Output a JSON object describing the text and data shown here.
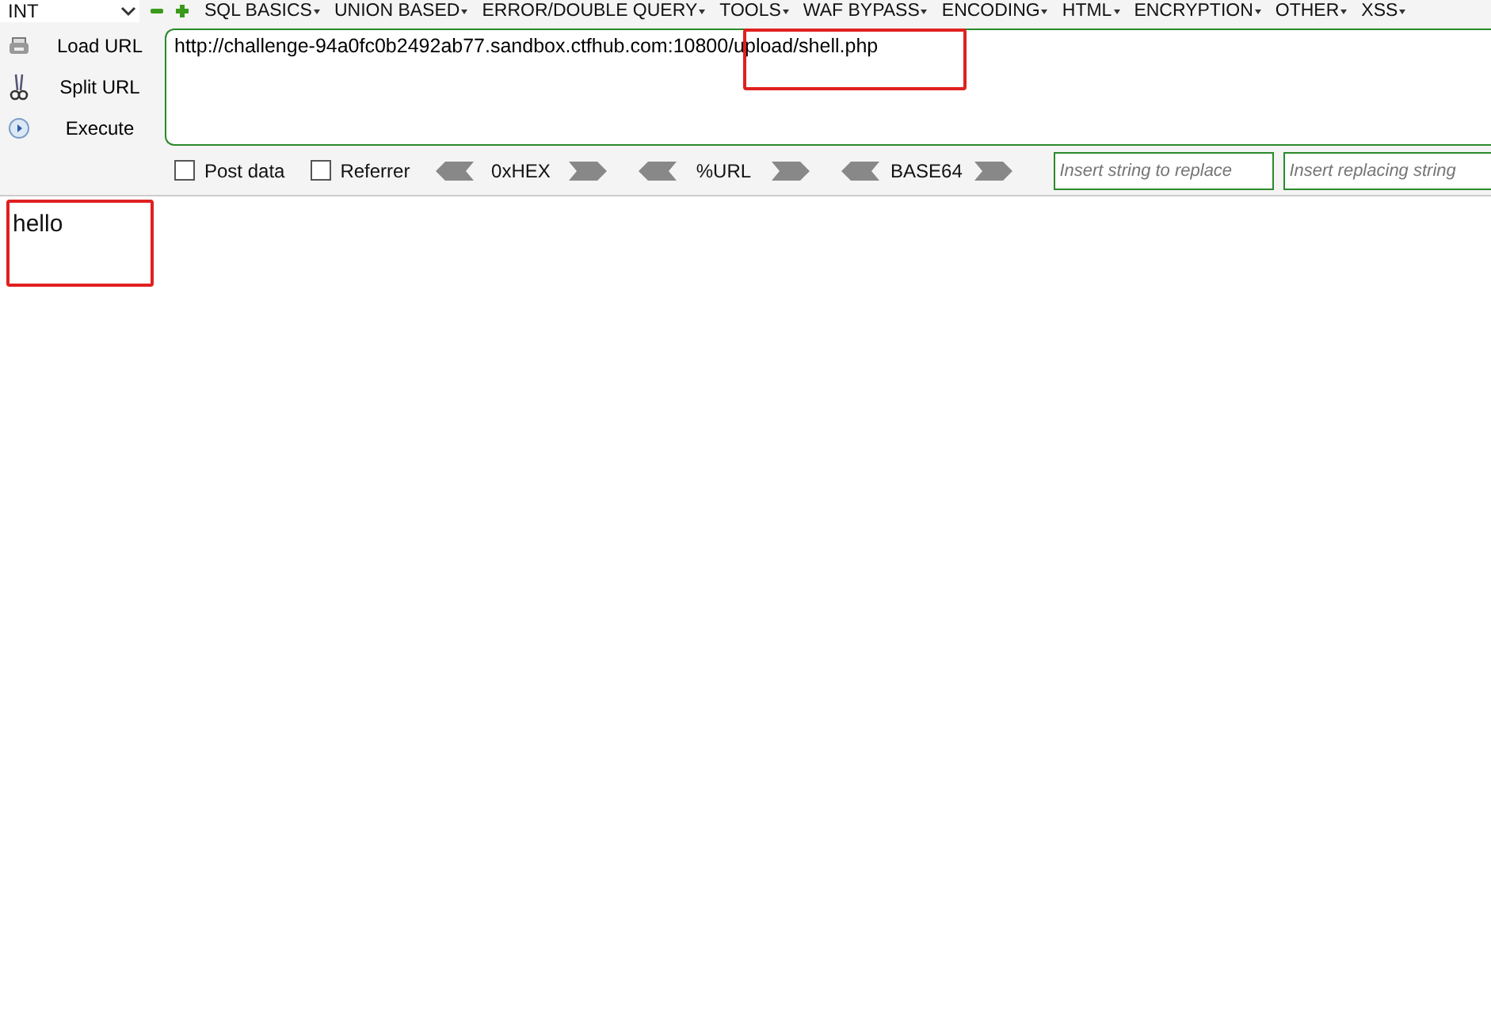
{
  "toolbar": {
    "select_value": "INT",
    "menus": [
      "SQL BASICS",
      "UNION BASED",
      "ERROR/DOUBLE QUERY",
      "TOOLS",
      "WAF BYPASS",
      "ENCODING",
      "HTML",
      "ENCRYPTION",
      "OTHER",
      "XSS"
    ]
  },
  "actions": [
    {
      "kind": "load",
      "label": "Load URL"
    },
    {
      "kind": "split",
      "label": "Split URL"
    },
    {
      "kind": "execute",
      "label": "Execute"
    }
  ],
  "url_field": {
    "value": "http://challenge-94a0fc0b2492ab77.sandbox.ctfhub.com:10800/upload/shell.php"
  },
  "options": [
    {
      "label": "Post data",
      "checked": false
    },
    {
      "label": "Referrer",
      "checked": false
    }
  ],
  "encoders": [
    "0xHEX",
    "%URL",
    "BASE64"
  ],
  "replace_fields": [
    {
      "placeholder": "Insert string to replace"
    },
    {
      "placeholder": "Insert replacing string"
    }
  ],
  "page": {
    "text": "hello"
  }
}
